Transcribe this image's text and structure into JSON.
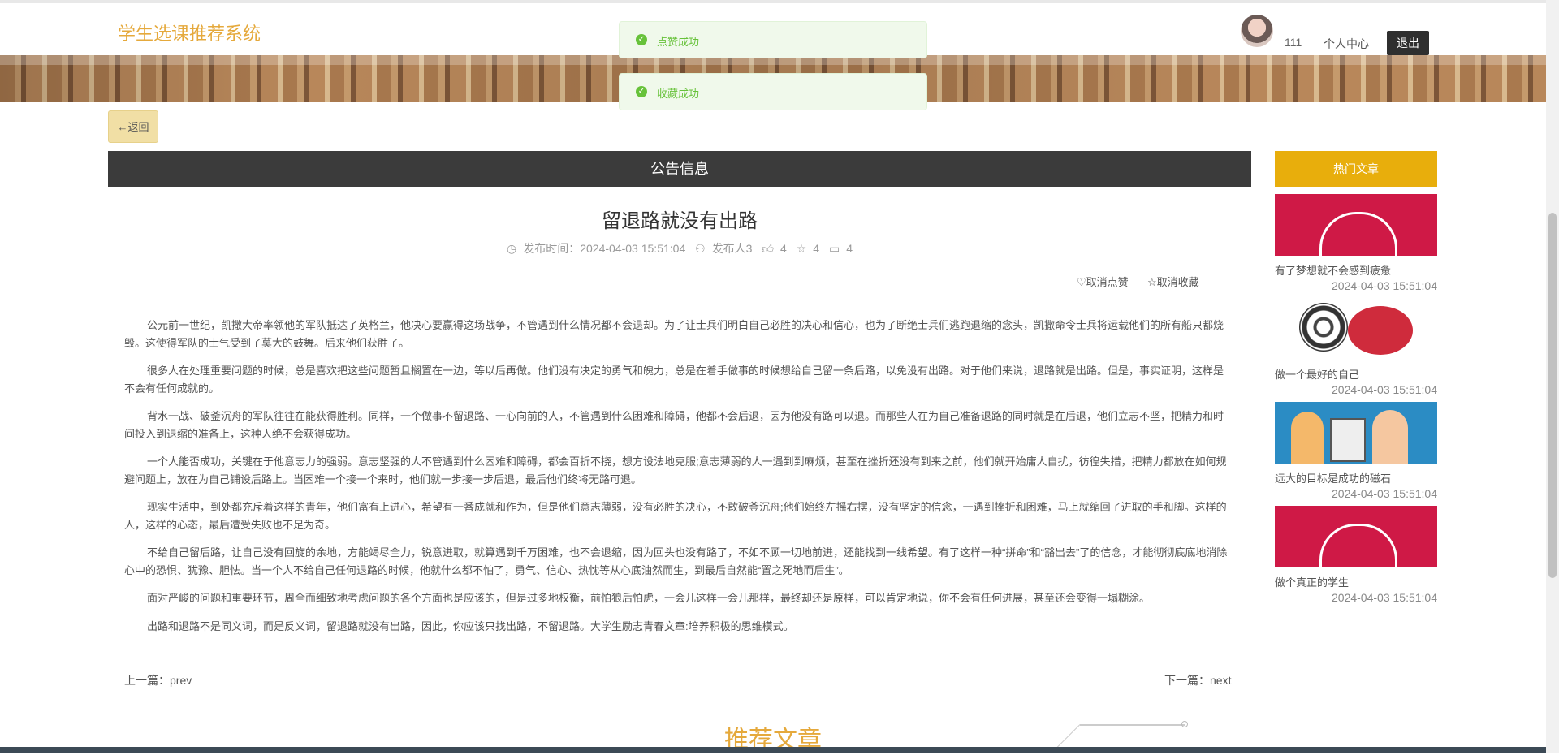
{
  "header": {
    "brand": "学生选课推荐系统",
    "username": "111",
    "profile_label": "个人中心",
    "logout_label": "退出"
  },
  "toasts": [
    {
      "message": "点赞成功",
      "icon": "check-circle-icon",
      "color": "#67c23a"
    },
    {
      "message": "收藏成功",
      "icon": "check-circle-icon",
      "color": "#67c23a"
    }
  ],
  "back_label": "←返回",
  "notice_bar_title": "公告信息",
  "article": {
    "title": "留退路就没有出路",
    "meta": {
      "publish_time": "发布时间：2024-04-03 15:51:04",
      "publisher": "发布人3",
      "likes": "4",
      "favorites": "4",
      "comments": "4"
    },
    "actions": {
      "unlike": "取消点赞",
      "unfavorite": "取消收藏"
    },
    "paragraphs": [
      "公元前一世纪，凯撒大帝率领他的军队抵达了英格兰，他决心要赢得这场战争，不管遇到什么情况都不会退却。为了让士兵们明白自己必胜的决心和信心，也为了断绝士兵们逃跑退缩的念头，凯撒命令士兵将运载他们的所有船只都烧毁。这使得军队的士气受到了莫大的鼓舞。后来他们获胜了。",
      "很多人在处理重要问题的时候，总是喜欢把这些问题暂且搁置在一边，等以后再做。他们没有决定的勇气和魄力，总是在着手做事的时候想给自己留一条后路，以免没有出路。对于他们来说，退路就是出路。但是，事实证明，这样是不会有任何成就的。",
      "背水一战、破釜沉舟的军队往往在能获得胜利。同样，一个做事不留退路、一心向前的人，不管遇到什么困难和障碍，他都不会后退，因为他没有路可以退。而那些人在为自己准备退路的同时就是在后退，他们立志不坚，把精力和时间投入到退缩的准备上，这种人绝不会获得成功。",
      "一个人能否成功，关键在于他意志力的强弱。意志坚强的人不管遇到什么困难和障碍，都会百折不挠，想方设法地克服;意志薄弱的人一遇到到麻烦，甚至在挫折还没有到来之前，他们就开始庸人自扰，彷徨失措，把精力都放在如何规避问题上，放在为自己铺设后路上。当困难一个接一个来时，他们就一步接一步后退，最后他们终将无路可退。",
      "现实生活中，到处都充斥着这样的青年，他们富有上进心，希望有一番成就和作为，但是他们意志薄弱，没有必胜的决心，不敢破釜沉舟;他们始终左摇右摆，没有坚定的信念，一遇到挫折和困难，马上就缩回了进取的手和脚。这样的人，这样的心态，最后遭受失败也不足为奇。",
      "不给自己留后路，让自己没有回旋的余地，方能竭尽全力，锐意进取，就算遇到千万困难，也不会退缩，因为回头也没有路了，不如不顾一切地前进，还能找到一线希望。有了这样一种“拼命”和“豁出去”了的信念，才能彻彻底底地消除心中的恐惧、犹豫、胆怯。当一个人不给自己任何退路的时候，他就什么都不怕了，勇气、信心、热忱等从心底油然而生，到最后自然能“置之死地而后生”。",
      "面对严峻的问题和重要环节，周全而细致地考虑问题的各个方面也是应该的，但是过多地权衡，前怕狼后怕虎，一会儿这样一会儿那样，最终却还是原样，可以肯定地说，你不会有任何进展，甚至还会变得一塌糊涂。",
      "出路和退路不是同义词，而是反义词，留退路就没有出路，因此，你应该只找出路，不留退路。大学生励志青春文章:培养积极的思维模式。"
    ],
    "prev": "上一篇：prev",
    "next": "下一篇：next"
  },
  "sidebar": {
    "header": "热门文章",
    "items": [
      {
        "title": "有了梦想就不会感到疲惫",
        "date": "2024-04-03 15:51:04"
      },
      {
        "title": "做一个最好的自己",
        "date": "2024-04-03 15:51:04"
      },
      {
        "title": "远大的目标是成功的磁石",
        "date": "2024-04-03 15:51:04"
      },
      {
        "title": "做个真正的学生",
        "date": "2024-04-03 15:51:04"
      }
    ]
  },
  "recommend_title": "推荐文章"
}
